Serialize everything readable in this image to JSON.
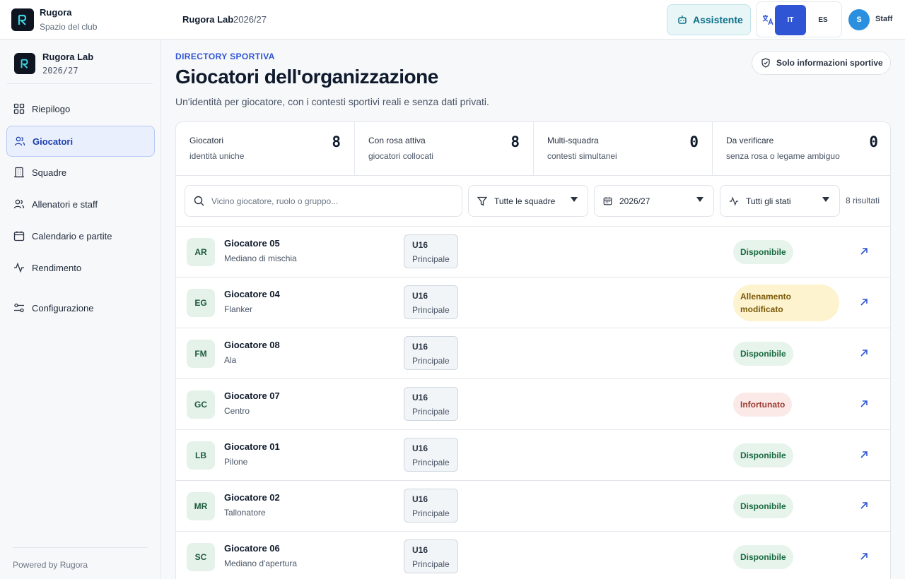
{
  "topbar": {
    "brand_name": "Rugora",
    "brand_sub": "Spazio del club",
    "context_name": "Rugora Lab",
    "context_season": "2026/27",
    "assistant_label": "Assistente",
    "lang_it": "IT",
    "lang_es": "ES",
    "user_initial": "S",
    "user_role": "Staff"
  },
  "sidebar": {
    "org_name": "Rugora Lab",
    "org_season": "2026/27",
    "items": [
      {
        "label": "Riepilogo",
        "icon": "grid-icon"
      },
      {
        "label": "Giocatori",
        "icon": "users-icon"
      },
      {
        "label": "Squadre",
        "icon": "building-icon"
      },
      {
        "label": "Allenatori e staff",
        "icon": "users-icon"
      },
      {
        "label": "Calendario e partite",
        "icon": "calendar-icon"
      },
      {
        "label": "Rendimento",
        "icon": "activity-icon"
      },
      {
        "label": "Configurazione",
        "icon": "settings-sliders-icon"
      }
    ],
    "powered_by": "Powered by Rugora"
  },
  "header": {
    "eyebrow": "DIRECTORY SPORTIVA",
    "title": "Giocatori dell'organizzazione",
    "subtitle": "Un'identità per giocatore, con i contesti sportivi reali e senza dati privati.",
    "badge": "Solo informazioni sportive"
  },
  "stats": [
    {
      "label": "Giocatori",
      "sub": "identità uniche",
      "value": "8"
    },
    {
      "label": "Con rosa attiva",
      "sub": "giocatori collocati",
      "value": "8"
    },
    {
      "label": "Multi-squadra",
      "sub": "contesti simultanei",
      "value": "0"
    },
    {
      "label": "Da verificare",
      "sub": "senza rosa o legame ambiguo",
      "value": "0"
    }
  ],
  "filters": {
    "search_placeholder": "Vicino giocatore, ruolo o gruppo...",
    "team": "Tutte le squadre",
    "season": "2026/27",
    "state": "Tutti gli stati",
    "results": "8 risultati"
  },
  "players": [
    {
      "initials": "AR",
      "name": "Giocatore 05",
      "role": "Mediano di mischia",
      "age": "U16",
      "team": "Principale",
      "status": "Disponibile",
      "kind": "ok"
    },
    {
      "initials": "EG",
      "name": "Giocatore 04",
      "role": "Flanker",
      "age": "U16",
      "team": "Principale",
      "status": "Allenamento modificato",
      "kind": "mod"
    },
    {
      "initials": "FM",
      "name": "Giocatore 08",
      "role": "Ala",
      "age": "U16",
      "team": "Principale",
      "status": "Disponibile",
      "kind": "ok"
    },
    {
      "initials": "GC",
      "name": "Giocatore 07",
      "role": "Centro",
      "age": "U16",
      "team": "Principale",
      "status": "Infortunato",
      "kind": "inj"
    },
    {
      "initials": "LB",
      "name": "Giocatore 01",
      "role": "Pilone",
      "age": "U16",
      "team": "Principale",
      "status": "Disponibile",
      "kind": "ok"
    },
    {
      "initials": "MR",
      "name": "Giocatore 02",
      "role": "Tallonatore",
      "age": "U16",
      "team": "Principale",
      "status": "Disponibile",
      "kind": "ok"
    },
    {
      "initials": "SC",
      "name": "Giocatore 06",
      "role": "Mediano d'apertura",
      "age": "U16",
      "team": "Principale",
      "status": "Disponibile",
      "kind": "ok"
    }
  ]
}
